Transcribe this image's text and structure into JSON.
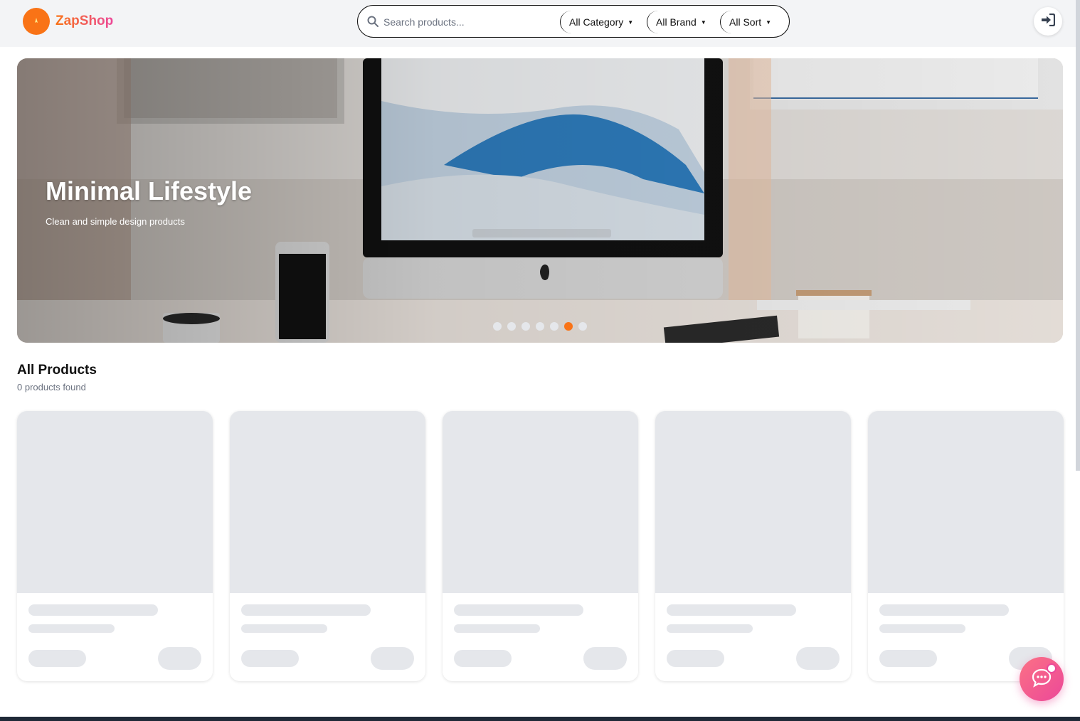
{
  "header": {
    "brand": "ZapShop",
    "search_placeholder": "Search products...",
    "filters": {
      "category": "All Category",
      "brand": "All Brand",
      "sort": "All Sort"
    }
  },
  "hero": {
    "title": "Minimal Lifestyle",
    "subtitle": "Clean and simple design products",
    "slide_count": 7,
    "active_slide": 6
  },
  "products": {
    "title": "All Products",
    "count_text": "0 products found",
    "skeleton_cards": 5
  },
  "colors": {
    "accent": "#f97316",
    "brand_gradient_end": "#ec4899",
    "skeleton": "#e5e7eb"
  },
  "icons": {
    "search": "search-icon",
    "login": "sign-in-icon",
    "chat": "chat-icon"
  }
}
